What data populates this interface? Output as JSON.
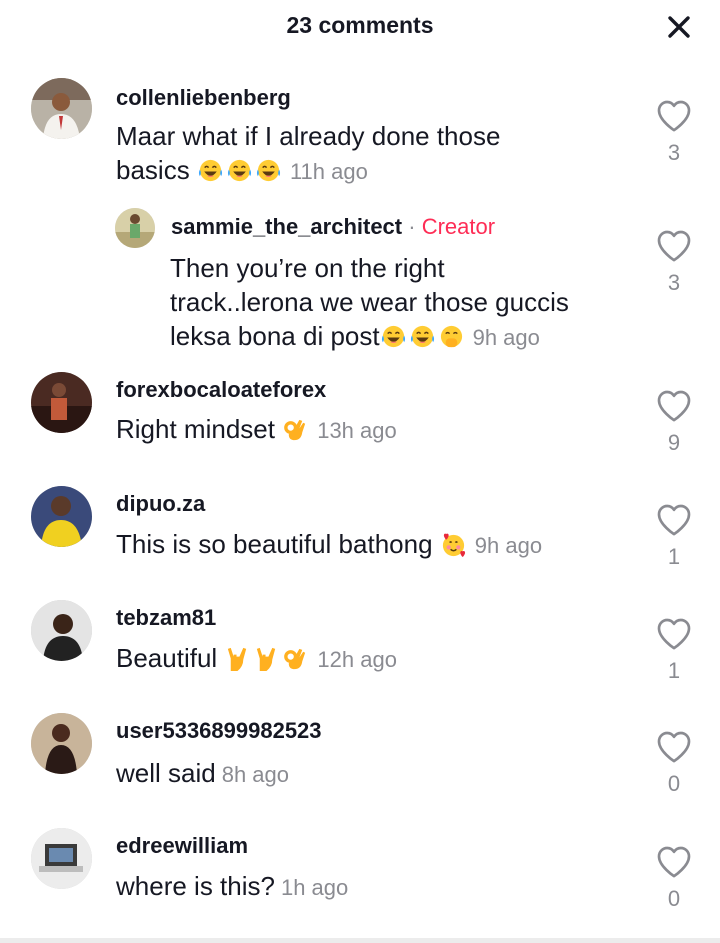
{
  "header": {
    "title": "23 comments"
  },
  "comments": [
    {
      "username": "collenliebenberg",
      "text": "Maar what if I already done those",
      "text2": "basics",
      "time": "11h ago",
      "likes": "3"
    },
    {
      "username": "sammie_the_architect",
      "separator": " · ",
      "tag": "Creator",
      "text": "Then you’re on the right",
      "text2": "track..lerona we wear those guccis",
      "text3": "leksa bona di post",
      "time": "9h ago",
      "likes": "3"
    },
    {
      "username": "forexbocaloateforex",
      "text": "Right mindset",
      "time": "13h ago",
      "likes": "9"
    },
    {
      "username": "dipuo.za",
      "text": "This is so beautiful bathong",
      "time": "9h ago",
      "likes": "1"
    },
    {
      "username": "tebzam81",
      "text": "Beautiful",
      "time": "12h ago",
      "likes": "1"
    },
    {
      "username": "user5336899982523",
      "text": "well said",
      "time": "8h ago",
      "likes": "0"
    },
    {
      "username": "edreewilliam",
      "text": "where is this?",
      "time": "1h ago",
      "likes": "0"
    }
  ],
  "icons": {
    "close": "close-icon",
    "like": "heart-outline-icon",
    "emojis": [
      "tears-of-joy-emoji",
      "ok-hand-emoji",
      "smiling-face-with-hearts-emoji",
      "face-with-hand-over-mouth-emoji",
      "sign-of-the-horns-emoji"
    ]
  },
  "colors": {
    "creator_tag": "#fe2c55",
    "muted": "#8a8b91",
    "text": "#161823"
  }
}
